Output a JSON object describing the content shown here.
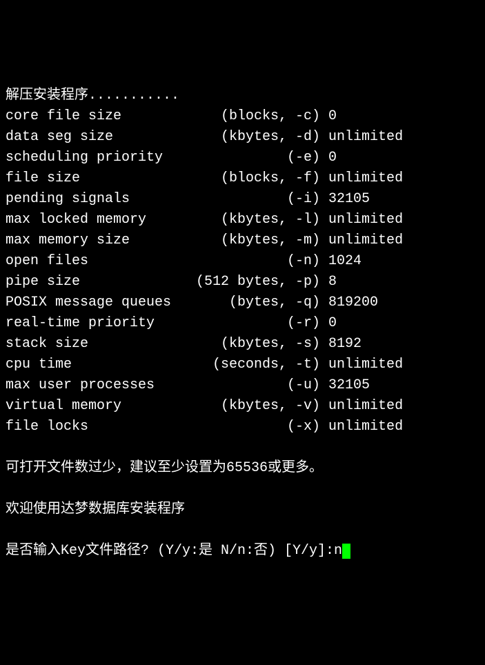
{
  "header": "解压安装程序...........",
  "limits": [
    {
      "name": "core file size",
      "unit": "(blocks, -c)",
      "value": "0"
    },
    {
      "name": "data seg size",
      "unit": "(kbytes, -d)",
      "value": "unlimited"
    },
    {
      "name": "scheduling priority",
      "unit": "(-e)",
      "value": "0"
    },
    {
      "name": "file size",
      "unit": "(blocks, -f)",
      "value": "unlimited"
    },
    {
      "name": "pending signals",
      "unit": "(-i)",
      "value": "32105"
    },
    {
      "name": "max locked memory",
      "unit": "(kbytes, -l)",
      "value": "unlimited"
    },
    {
      "name": "max memory size",
      "unit": "(kbytes, -m)",
      "value": "unlimited"
    },
    {
      "name": "open files",
      "unit": "(-n)",
      "value": "1024"
    },
    {
      "name": "pipe size",
      "unit": "(512 bytes, -p)",
      "value": "8"
    },
    {
      "name": "POSIX message queues",
      "unit": "(bytes, -q)",
      "value": "819200"
    },
    {
      "name": "real-time priority",
      "unit": "(-r)",
      "value": "0"
    },
    {
      "name": "stack size",
      "unit": "(kbytes, -s)",
      "value": "8192"
    },
    {
      "name": "cpu time",
      "unit": "(seconds, -t)",
      "value": "unlimited"
    },
    {
      "name": "max user processes",
      "unit": "(-u)",
      "value": "32105"
    },
    {
      "name": "virtual memory",
      "unit": "(kbytes, -v)",
      "value": "unlimited"
    },
    {
      "name": "file locks",
      "unit": "(-x)",
      "value": "unlimited"
    }
  ],
  "warning": "可打开文件数过少，建议至少设置为65536或更多。",
  "welcome": "欢迎使用达梦数据库安装程序",
  "prompt": {
    "question": "是否输入Key文件路径? (Y/y:是 N/n:否) [Y/y]:",
    "input": "n"
  }
}
